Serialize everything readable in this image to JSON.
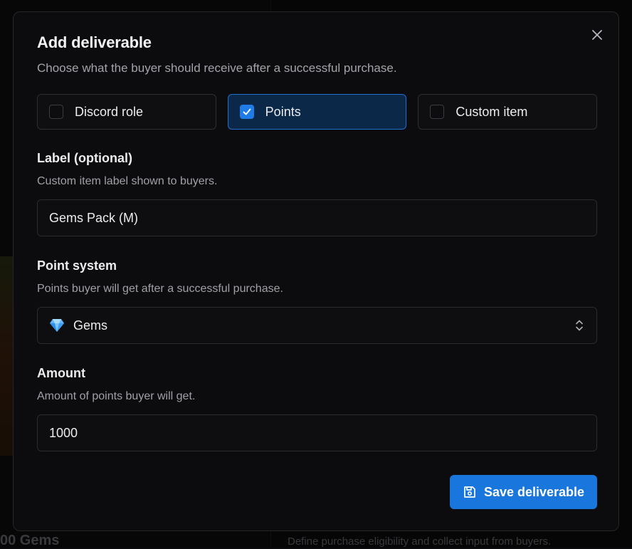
{
  "dialog": {
    "title": "Add deliverable",
    "subtitle": "Choose what the buyer should receive after a successful purchase.",
    "close_icon": "close-icon"
  },
  "deliverable_types": [
    {
      "label": "Discord role",
      "checked": false
    },
    {
      "label": "Points",
      "checked": true
    },
    {
      "label": "Custom item",
      "checked": false
    }
  ],
  "label_field": {
    "label": "Label (optional)",
    "help": "Custom item label shown to buyers.",
    "value": "Gems Pack (M)"
  },
  "point_system": {
    "label": "Point system",
    "help": "Points buyer will get after a successful purchase.",
    "selected": "Gems",
    "icon": "gem-icon"
  },
  "amount": {
    "label": "Amount",
    "help": "Amount of points buyer will get.",
    "value": "1000"
  },
  "save_button": {
    "label": "Save deliverable",
    "icon": "save-icon"
  },
  "background": {
    "bottom_left_text": "00 Gems",
    "bottom_right_text": "Define purchase eligibility and collect input from buyers."
  },
  "colors": {
    "accent": "#1876dc",
    "selected_card_bg": "#0b2848",
    "selected_card_border": "#1f6fd1",
    "modal_bg": "#0c0c0e"
  }
}
